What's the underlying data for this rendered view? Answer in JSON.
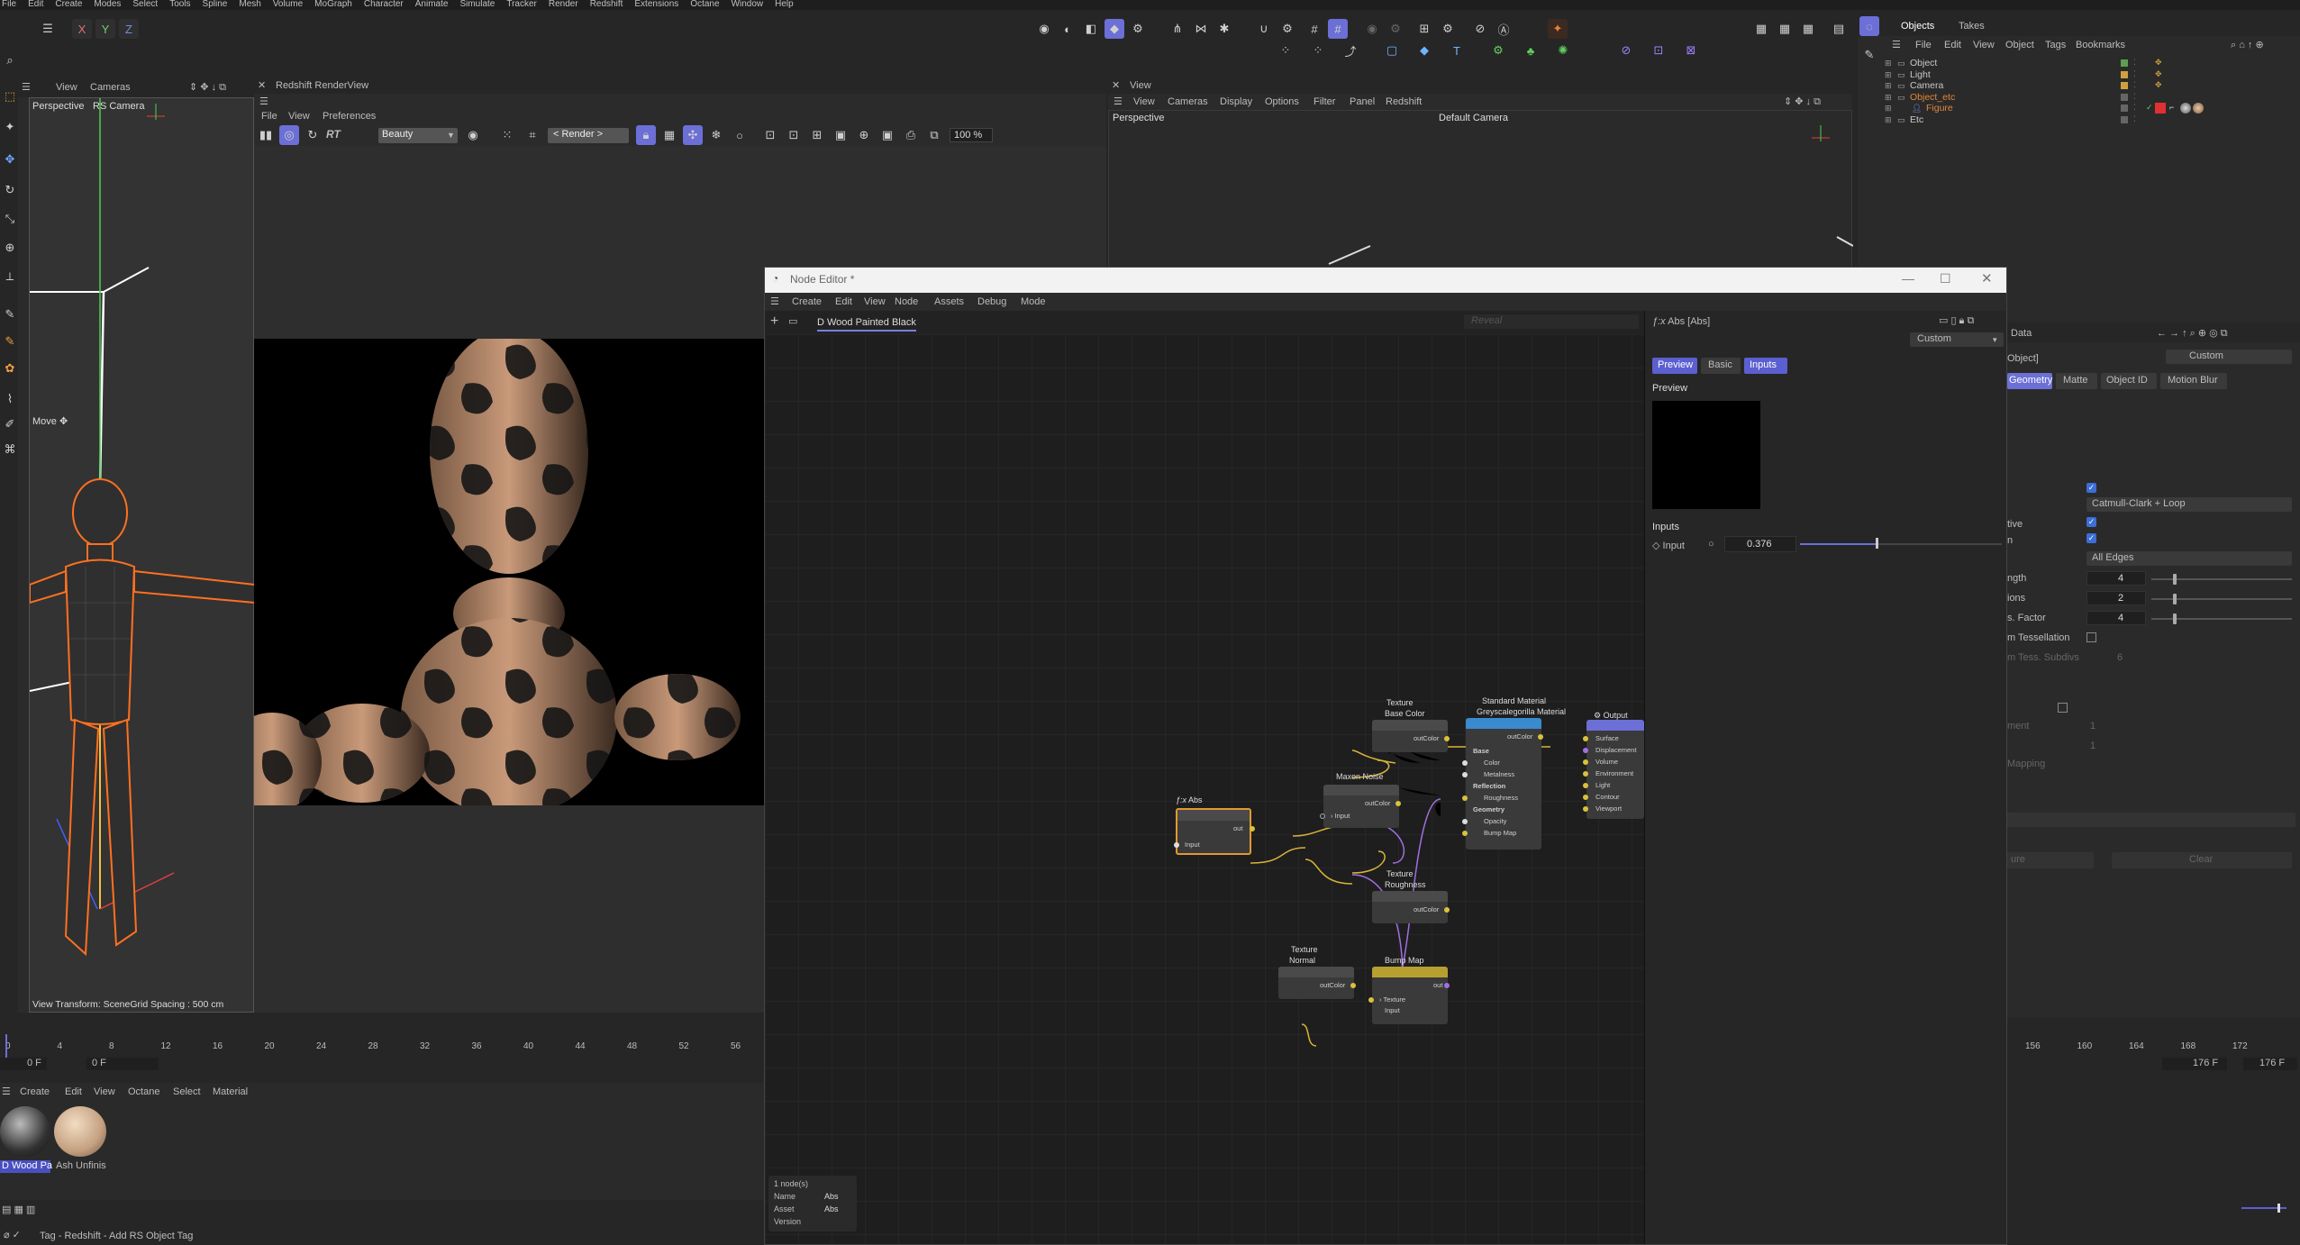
{
  "menubar": [
    "File",
    "Edit",
    "Create",
    "Modes",
    "Select",
    "Tools",
    "Spline",
    "Mesh",
    "Volume",
    "MoGraph",
    "Character",
    "Animate",
    "Simulate",
    "Tracker",
    "Render",
    "Redshift",
    "Extensions",
    "Octane",
    "Window",
    "Help"
  ],
  "axis_buttons": [
    "X",
    "Y",
    "Z"
  ],
  "left_viewport": {
    "menus": [
      "View",
      "Cameras"
    ],
    "camera_mode": "Perspective",
    "camera_name": "RS Camera",
    "tool_label": "Move",
    "status": "View Transform: SceneGrid Spacing : 500 cm"
  },
  "renderview": {
    "title": "Redshift RenderView",
    "menus": [
      "File",
      "View",
      "Preferences"
    ],
    "rt_label": "RT",
    "aov": "Beauty",
    "render_btn": "< Render >",
    "zoom": "100 %"
  },
  "right_viewport": {
    "title": "View",
    "menus": [
      "View",
      "Cameras",
      "Display",
      "Options",
      "Filter",
      "Panel",
      "Redshift"
    ],
    "camera_mode": "Perspective",
    "camera_name": "Default Camera"
  },
  "objects_panel": {
    "tabs": [
      "Objects",
      "Takes"
    ],
    "menus": [
      "File",
      "Edit",
      "View",
      "Object",
      "Tags",
      "Bookmarks"
    ],
    "items": [
      {
        "name": "Object",
        "color": "#c8c8c8"
      },
      {
        "name": "Light",
        "color": "#c8c8c8"
      },
      {
        "name": "Camera",
        "color": "#c8c8c8"
      },
      {
        "name": "Object_etc",
        "color": "#e0873a"
      },
      {
        "name": "Figure",
        "color": "#e0873a"
      },
      {
        "name": "Etc",
        "color": "#c8c8c8"
      }
    ]
  },
  "attributes_panel": {
    "header": "Data",
    "object_label": "Object]",
    "mode_value": "Custom",
    "tabs": [
      "Geometry",
      "Matte",
      "Object ID",
      "Motion Blur"
    ],
    "subdiv_type": "Catmull-Clark + Loop",
    "edges": "All Edges",
    "labels": [
      "tive",
      "n",
      "ngth",
      "ions",
      "s. Factor",
      "m Tessellation",
      "m Tess. Subdivs",
      "ment",
      "Mapping"
    ],
    "values": [
      "4",
      "2",
      "4",
      "6",
      "1",
      "1"
    ],
    "buttons": [
      "ure",
      "Clear"
    ]
  },
  "timeline": {
    "ticks": [
      "0",
      "4",
      "8",
      "12",
      "16",
      "20",
      "24",
      "28",
      "32",
      "36",
      "40",
      "44",
      "48",
      "52",
      "56"
    ],
    "right_ticks": [
      "156",
      "160",
      "164",
      "168",
      "172"
    ],
    "start_frame": "0 F",
    "start_frame2": "0 F",
    "end_frame": "176 F",
    "end_frame2": "176 F"
  },
  "material_manager": {
    "menus": [
      "Create",
      "Edit",
      "View",
      "Octane",
      "Select",
      "Material"
    ],
    "materials": [
      "D Wood Pa",
      "Ash Unfinis"
    ]
  },
  "status_bar": "Tag - Redshift - Add RS Object Tag",
  "node_editor": {
    "title": "Node Editor *",
    "menus": [
      "Create",
      "Edit",
      "View",
      "Node",
      "Assets",
      "Debug",
      "Mode"
    ],
    "material_tab": "D Wood Painted Black",
    "search_placeholder": "Reveal",
    "inspector": {
      "title": "Abs [Abs]",
      "mode": "Custom",
      "tabs": [
        "Preview",
        "Basic",
        "Inputs"
      ],
      "preview_label": "Preview",
      "inputs_label": "Inputs",
      "input_name": "Input",
      "input_value": "0.376",
      "input_fraction": 0.376
    },
    "info": {
      "count": "1 node(s)",
      "name_label": "Name",
      "name_value": "Abs",
      "asset_label": "Asset",
      "asset_value": "Abs",
      "version_label": "Version"
    },
    "nodes": {
      "abs": {
        "title": "Abs",
        "in": "Input",
        "out": "out"
      },
      "noise": {
        "title": "Maxon Noise",
        "in": "Input",
        "out": "outColor"
      },
      "tex_base": {
        "subtitle": "Texture",
        "title": "Base Color",
        "out": "outColor"
      },
      "tex_rough": {
        "subtitle": "Texture",
        "title": "Roughness",
        "out": "outColor"
      },
      "tex_normal": {
        "subtitle": "Texture",
        "title": "Normal",
        "out": "outColor"
      },
      "bump": {
        "title": "Bump Map",
        "out": "out",
        "in1": "Texture",
        "in2": "Input"
      },
      "material": {
        "subtitle": "Standard Material",
        "title": "Greyscalegorilla Material",
        "out": "outColor",
        "ports": [
          "Base",
          "Color",
          "Metalness",
          "Reflection",
          "Roughness",
          "Geometry",
          "Opacity",
          "Bump Map"
        ]
      },
      "output": {
        "title": "Output",
        "ports": [
          "Surface",
          "Displacement",
          "Volume",
          "Environment",
          "Light",
          "Contour",
          "Viewport"
        ]
      }
    }
  }
}
